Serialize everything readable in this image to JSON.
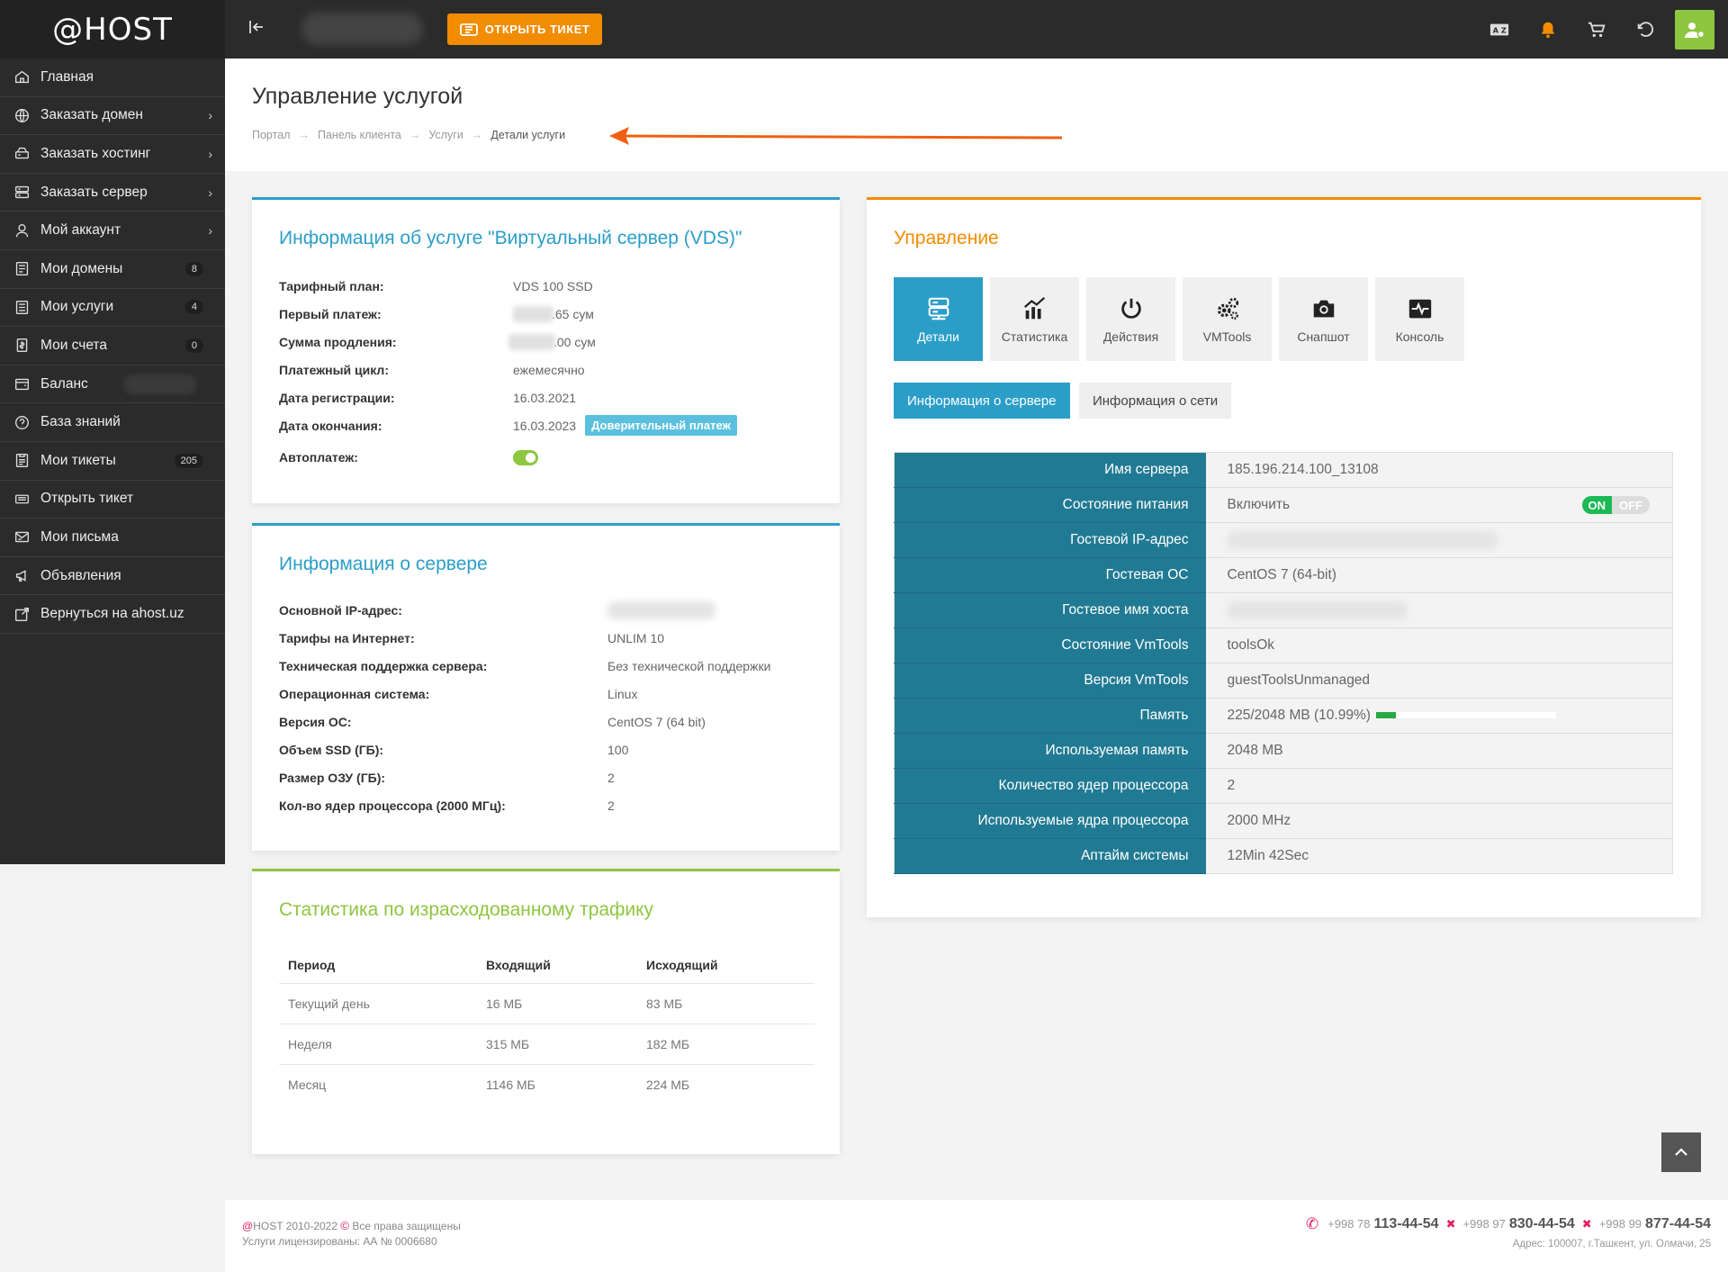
{
  "logo": "@HOST",
  "sidebar": {
    "items": [
      {
        "label": "Главная",
        "icon": "home-icon"
      },
      {
        "label": "Заказать домен",
        "icon": "globe-icon",
        "chevron": "›"
      },
      {
        "label": "Заказать хостинг",
        "icon": "hdd-icon",
        "chevron": "›"
      },
      {
        "label": "Заказать сервер",
        "icon": "server-icon",
        "chevron": "›"
      },
      {
        "label": "Мой аккаунт",
        "icon": "user-icon",
        "chevron": "›"
      },
      {
        "label": "Мои домены",
        "icon": "domains-icon",
        "badge": "8"
      },
      {
        "label": "Мои услуги",
        "icon": "services-icon",
        "badge": "4"
      },
      {
        "label": "Мои счета",
        "icon": "invoice-icon",
        "badge": "0"
      },
      {
        "label": "Баланс",
        "icon": "wallet-icon"
      },
      {
        "label": "База знаний",
        "icon": "help-icon"
      },
      {
        "label": "Мои тикеты",
        "icon": "tickets-icon",
        "badge": "205"
      },
      {
        "label": "Открыть тикет",
        "icon": "ticket-icon"
      },
      {
        "label": "Мои письма",
        "icon": "mail-icon"
      },
      {
        "label": "Объявления",
        "icon": "megaphone-icon"
      },
      {
        "label": "Вернуться на ahost.uz",
        "icon": "external-link-icon"
      }
    ]
  },
  "topbar": {
    "open_ticket": "ОТКРЫТЬ ТИКЕТ"
  },
  "page": {
    "title": "Управление услугой",
    "breadcrumb": [
      "Портал",
      "Панель клиента",
      "Услуги",
      "Детали услуги"
    ]
  },
  "service_info": {
    "title": "Информация об услуге \"Виртуальный сервер (VDS)\"",
    "rows": [
      {
        "label": "Тарифный план:",
        "value": "VDS 100 SSD"
      },
      {
        "label": "Первый платеж:",
        "value": ".65 сум"
      },
      {
        "label": "Сумма продления:",
        "value": ".00 сум"
      },
      {
        "label": "Платежный цикл:",
        "value": "ежемесячно"
      },
      {
        "label": "Дата регистрации:",
        "value": "16.03.2021"
      },
      {
        "label": "Дата окончания:",
        "value": "16.03.2023"
      },
      {
        "label": "Автоплатеж:",
        "value": ""
      }
    ],
    "trust_badge": "Доверительный платеж"
  },
  "server_info": {
    "title": "Информация о сервере",
    "rows": [
      {
        "label": "Основной IP-адрес:",
        "value": ""
      },
      {
        "label": "Тарифы на Интернет:",
        "value": "UNLIM 10"
      },
      {
        "label": "Техническая поддержка сервера:",
        "value": "Без технической поддержки"
      },
      {
        "label": "Операционная система:",
        "value": "Linux"
      },
      {
        "label": "Версия ОС:",
        "value": "CentOS 7 (64 bit)"
      },
      {
        "label": "Объем SSD (ГБ):",
        "value": "100"
      },
      {
        "label": "Размер ОЗУ (ГБ):",
        "value": "2"
      },
      {
        "label": "Кол-во ядер процессора (2000 МГц):",
        "value": "2"
      }
    ]
  },
  "traffic": {
    "title": "Статистика по израсходованному трафику",
    "headers": [
      "Период",
      "Входящий",
      "Исходящий"
    ],
    "rows": [
      [
        "Текущий день",
        "16 МБ",
        "83 МБ"
      ],
      [
        "Неделя",
        "315 МБ",
        "182 МБ"
      ],
      [
        "Месяц",
        "1146 МБ",
        "224 МБ"
      ]
    ]
  },
  "manage": {
    "title": "Управление",
    "tools": [
      {
        "label": "Детали",
        "icon": "server-details-icon",
        "active": true
      },
      {
        "label": "Статистика",
        "icon": "stats-chart-icon"
      },
      {
        "label": "Действия",
        "icon": "power-icon"
      },
      {
        "label": "VMTools",
        "icon": "gears-icon"
      },
      {
        "label": "Снапшот",
        "icon": "camera-icon"
      },
      {
        "label": "Консоль",
        "icon": "console-pulse-icon"
      }
    ],
    "subtabs": [
      "Информация о сервере",
      "Информация о сети"
    ],
    "details": [
      {
        "key": "Имя сервера",
        "value": "185.196.214.100_13108"
      },
      {
        "key": "Состояние питания",
        "value": "Включить"
      },
      {
        "key": "Гостевой IP-адрес",
        "value": ""
      },
      {
        "key": "Гостевая ОС",
        "value": "CentOS 7 (64-bit)"
      },
      {
        "key": "Гостевое имя хоста",
        "value": ""
      },
      {
        "key": "Состояние VmTools",
        "value": "toolsOk"
      },
      {
        "key": "Версия VmTools",
        "value": "guestToolsUnmanaged"
      },
      {
        "key": "Память",
        "value": "225/2048 MB (10.99%)"
      },
      {
        "key": "Используемая память",
        "value": "2048 MB"
      },
      {
        "key": "Количество ядер процессора",
        "value": "2"
      },
      {
        "key": "Используемые ядра процессора",
        "value": "2000 MHz"
      },
      {
        "key": "Аптайм системы",
        "value": "12Min 42Sec"
      }
    ],
    "power_on": "ON",
    "power_off": "OFF",
    "memory_fraction": 0.1099
  },
  "footer": {
    "copyright_brand": "@",
    "copyright": "HOST 2010-2022",
    "rights": "Все права защищены",
    "license": "Услуги лицензированы: АА № 0006680",
    "phones": [
      {
        "prefix": "+998 78",
        "number": "113-44-54"
      },
      {
        "prefix": "+998 97",
        "number": "830-44-54"
      },
      {
        "prefix": "+998 99",
        "number": "877-44-54"
      }
    ],
    "address": "Адрес: 100007, г.Ташкент, ул. Олмачи, 25"
  },
  "colors": {
    "accent_blue": "#2b9ec8",
    "table_key": "#217a93",
    "orange": "#f28c00",
    "green": "#8dc63f"
  }
}
